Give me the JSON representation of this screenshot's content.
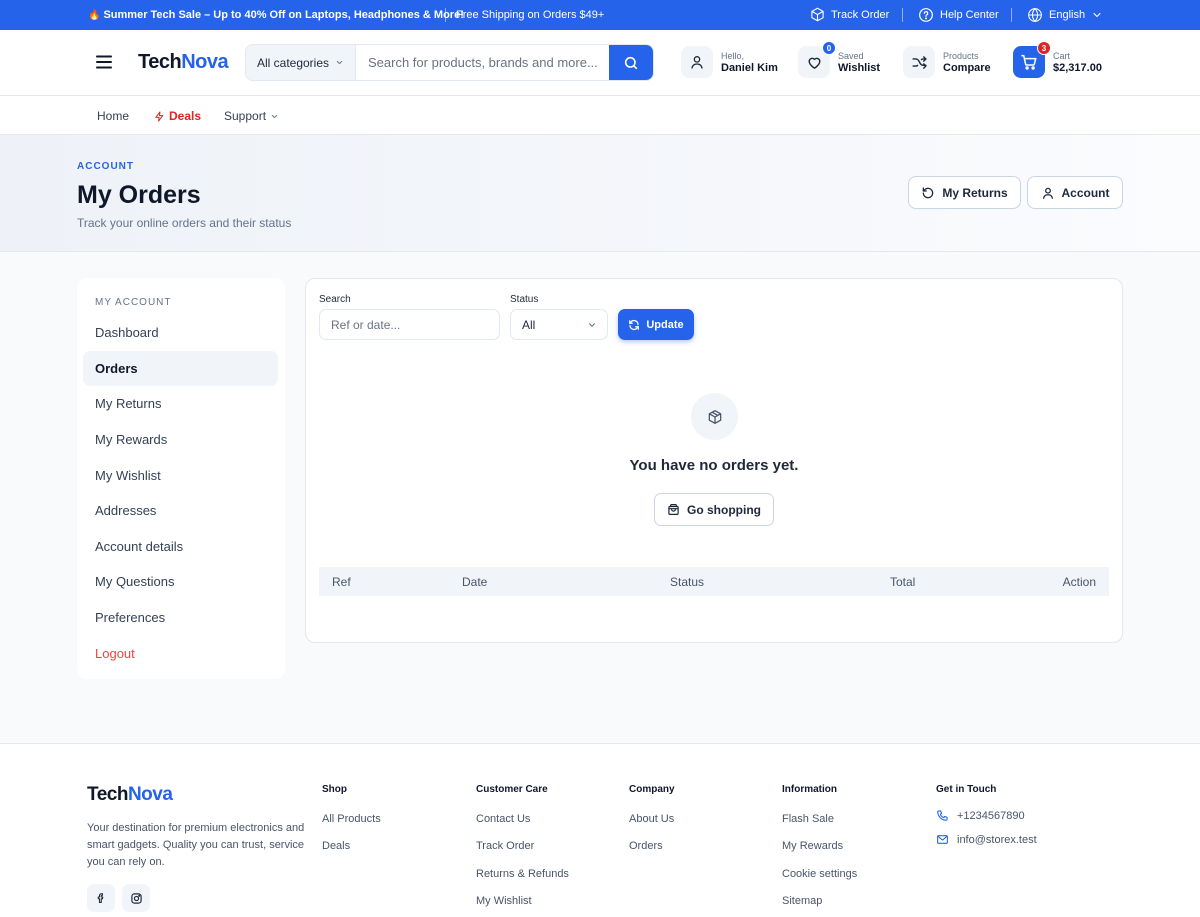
{
  "colors": {
    "primary": "#2563eb",
    "danger": "#dc2626",
    "badge_saved": "#2563eb",
    "badge_cart": "#dc2626"
  },
  "topbar": {
    "promo_emoji": "🔥",
    "promo": "Summer Tech Sale – Up to 40% Off on Laptops, Headphones & More!",
    "shipping": "Free Shipping on Orders $49+",
    "track_order": "Track Order",
    "help_center": "Help Center",
    "language": "English"
  },
  "header": {
    "logo_part1": "Tech",
    "logo_part2": "Nova",
    "category": "All categories",
    "search_placeholder": "Search for products, brands and more...",
    "account": {
      "small": "Hello,",
      "big": "Daniel Kim"
    },
    "wishlist": {
      "small": "Saved",
      "big": "Wishlist",
      "count": "0"
    },
    "compare": {
      "small": "Products",
      "big": "Compare"
    },
    "cart": {
      "small": "Cart",
      "big": "$2,317.00",
      "count": "3"
    }
  },
  "nav": {
    "home": "Home",
    "deals": "Deals",
    "support": "Support"
  },
  "hero": {
    "eyebrow": "ACCOUNT",
    "title": "My Orders",
    "subtitle": "Track your online orders and their status",
    "returns_btn": "My Returns",
    "account_btn": "Account"
  },
  "sidebar": {
    "heading": "MY ACCOUNT",
    "items": [
      {
        "label": "Dashboard"
      },
      {
        "label": "Orders"
      },
      {
        "label": "My Returns"
      },
      {
        "label": "My Rewards"
      },
      {
        "label": "My Wishlist"
      },
      {
        "label": "Addresses"
      },
      {
        "label": "Account details"
      },
      {
        "label": "My Questions"
      },
      {
        "label": "Preferences"
      },
      {
        "label": "Logout"
      }
    ]
  },
  "orders": {
    "search_label": "Search",
    "search_placeholder": "Ref or date...",
    "status_label": "Status",
    "status_value": "All",
    "update_btn": "Update",
    "empty_message": "You have no orders yet.",
    "go_shopping": "Go shopping",
    "columns": [
      "Ref",
      "Date",
      "Status",
      "Total",
      "Action"
    ]
  },
  "footer": {
    "logo_part1": "Tech",
    "logo_part2": "Nova",
    "description": "Your destination for premium electronics and smart gadgets. Quality you can trust, service you can rely on.",
    "shop": {
      "title": "Shop",
      "links": [
        "All Products",
        "Deals"
      ]
    },
    "care": {
      "title": "Customer Care",
      "links": [
        "Contact Us",
        "Track Order",
        "Returns & Refunds",
        "My Wishlist"
      ]
    },
    "company": {
      "title": "Company",
      "links": [
        "About Us",
        "Orders"
      ]
    },
    "info": {
      "title": "Information",
      "links": [
        "Flash Sale",
        "My Rewards",
        "Cookie settings",
        "Sitemap"
      ]
    },
    "contact": {
      "title": "Get in Touch",
      "phone": "+1234567890",
      "email": "info@storex.test"
    }
  }
}
